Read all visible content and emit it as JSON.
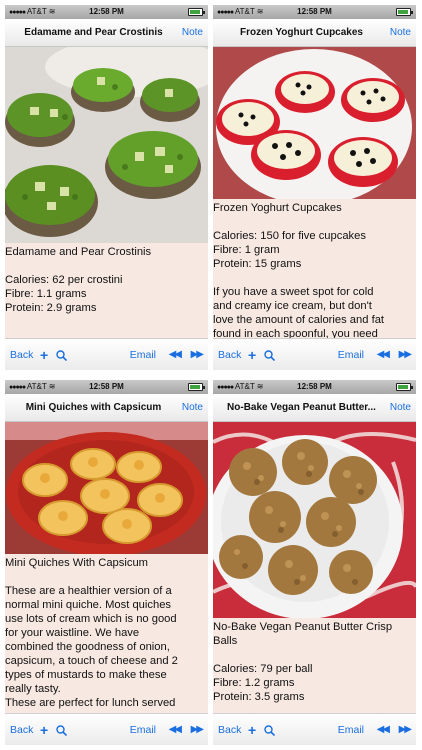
{
  "status_bar": {
    "carrier": "AT&T",
    "time": "12:58 PM",
    "battery_level": 0.9
  },
  "navbar": {
    "note_label": "Note"
  },
  "toolbar": {
    "back_label": "Back",
    "plus_label": "+",
    "email_label": "Email",
    "prev_label": "◀◀",
    "next_label": "▶▶"
  },
  "screens": [
    {
      "title": "Edamame and Pear Crostinis",
      "photo_icon": "crostini-photo",
      "recipe_name": "Edamame and Pear Crostinis",
      "calories": "Calories: 62 per crostini",
      "fibre": "Fibre: 1.1 grams",
      "protein": "Protein: 2.9 grams",
      "body_lines": []
    },
    {
      "title": "Frozen Yoghurt Cupcakes",
      "photo_icon": "cupcakes-photo",
      "recipe_name": "Frozen Yoghurt Cupcakes",
      "calories": "Calories: 150 for five cupcakes",
      "fibre": "Fibre: 1 gram",
      "protein": "Protein: 15 grams",
      "body_lines": [
        "If you have a sweet spot for cold",
        "and creamy ice cream, but don't",
        "love the amount of calories and fat",
        "found in each spoonful, you need"
      ]
    },
    {
      "title": "Mini Quiches with Capsicum",
      "photo_icon": "quiches-photo",
      "recipe_name": "Mini Quiches With Capsicum",
      "body_lines": [
        "These are a healthier version of a",
        "normal mini quiche. Most quiches",
        "use lots of cream which is no good",
        "for your waistline. We have",
        "combined the goodness of onion,",
        "capsicum, a touch of cheese and 2",
        "types of mustards to make these",
        "really tasty.",
        "These are perfect for lunch served"
      ]
    },
    {
      "title": "No-Bake Vegan Peanut Butter...",
      "photo_icon": "energy-balls-photo",
      "recipe_name_lines": [
        "No-Bake Vegan Peanut Butter Crisp",
        "Balls"
      ],
      "calories": "Calories: 79 per ball",
      "fibre": "Fibre: 1.2 grams",
      "protein": "Protein: 3.5 grams",
      "body_lines": []
    }
  ]
}
